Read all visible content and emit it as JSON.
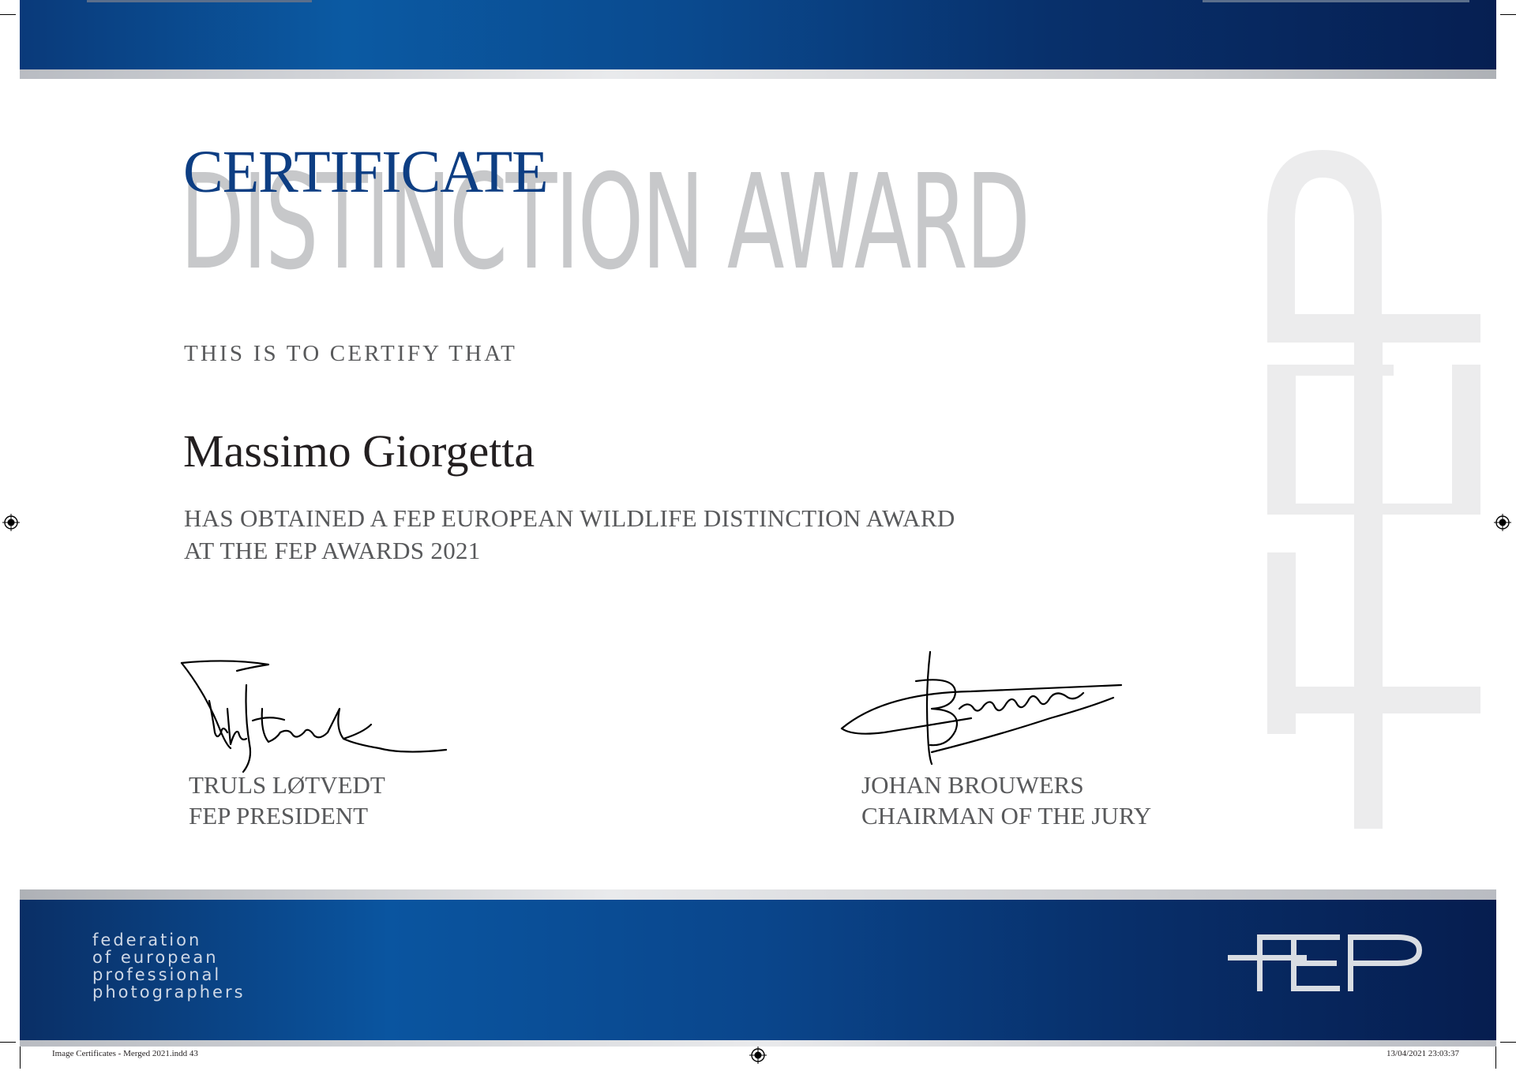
{
  "certificate": {
    "title": "CERTIFICATE",
    "subtitle": "DISTINCTION AWARD",
    "certify_line": "THIS IS TO CERTIFY THAT",
    "recipient": "Massimo Giorgetta",
    "award_line_1": "HAS OBTAINED A FEP EUROPEAN WILDLIFE DISTINCTION AWARD",
    "award_line_2": "AT THE FEP AWARDS 2021"
  },
  "signatories": [
    {
      "name": "TRULS LØTVEDT",
      "role": "FEP PRESIDENT"
    },
    {
      "name": "JOHAN BROUWERS",
      "role": "CHAIRMAN OF THE JURY"
    }
  ],
  "organization": {
    "full_name": "federation\nof european\nprofessional\nphotographers",
    "logo_text": "FEP"
  },
  "print_slug": {
    "file": "Image Certificates - Merged 2021.indd   43",
    "timestamp": "13/04/2021   23:03:37"
  },
  "colors": {
    "brand_blue": "#0d3e83",
    "band_dark": "#061d4f",
    "watermark_grey": "#c7c8ca",
    "text_grey": "#58595b"
  },
  "icons": [
    "registration-mark-icon",
    "crop-mark-icon",
    "fep-logo-icon",
    "fep-watermark-icon"
  ]
}
